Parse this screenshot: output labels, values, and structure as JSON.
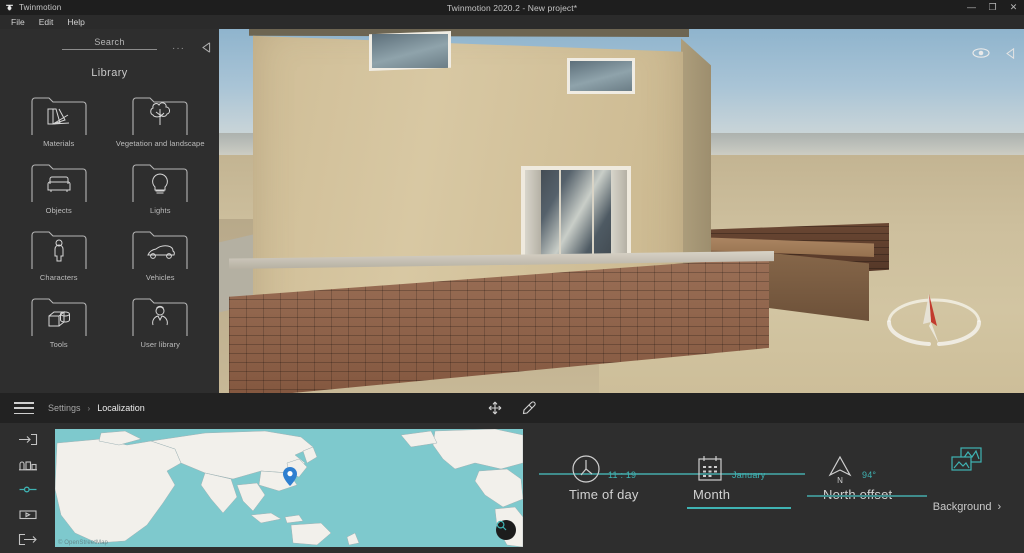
{
  "window": {
    "app_name": "Twinmotion",
    "title": "Twinmotion 2020.2 - New project*",
    "controls": {
      "minimize": "—",
      "maximize": "❐",
      "close": "✕"
    }
  },
  "menubar": {
    "items": [
      "File",
      "Edit",
      "Help"
    ]
  },
  "library": {
    "search_placeholder": "Search",
    "search_value": "Search",
    "more_label": "···",
    "title": "Library",
    "categories": [
      {
        "label": "Materials",
        "icon": "materials-folder-icon"
      },
      {
        "label": "Vegetation and landscape",
        "icon": "vegetation-folder-icon"
      },
      {
        "label": "Objects",
        "icon": "objects-folder-icon"
      },
      {
        "label": "Lights",
        "icon": "lights-folder-icon"
      },
      {
        "label": "Characters",
        "icon": "characters-folder-icon"
      },
      {
        "label": "Vehicles",
        "icon": "vehicles-folder-icon"
      },
      {
        "label": "Tools",
        "icon": "tools-folder-icon"
      },
      {
        "label": "User library",
        "icon": "user-library-folder-icon"
      }
    ]
  },
  "viewport": {
    "eye_icon": "visibility-eye-icon",
    "collapse_icon": "collapse-right-icon",
    "compass_icon": "compass-gizmo"
  },
  "bottombar": {
    "menu_icon": "hamburger-menu-icon",
    "breadcrumb": {
      "parent": "Settings",
      "separator": "›",
      "current": "Localization"
    },
    "tools": [
      {
        "name": "move-tool-icon"
      },
      {
        "name": "eyedropper-tool-icon"
      }
    ]
  },
  "rail": {
    "items": [
      {
        "name": "import-icon",
        "active": false
      },
      {
        "name": "urban-context-icon",
        "active": false
      },
      {
        "name": "settings-icon",
        "active": true
      },
      {
        "name": "media-icon",
        "active": false
      },
      {
        "name": "export-icon",
        "active": false
      }
    ]
  },
  "map": {
    "attribution": "© OpenStreetMap",
    "pin_label": "location-pin",
    "search_icon": "map-search-icon",
    "land_color": "#f2f0eb",
    "water_color": "#7ec9cd",
    "pin_color": "#2e7fd0"
  },
  "localization": {
    "accent_color": "#3fb3b3",
    "controls": [
      {
        "name": "Time of day",
        "value": "11 : 19",
        "icon": "clock-icon",
        "active": false
      },
      {
        "name": "Month",
        "value": "January",
        "icon": "calendar-icon",
        "active": true
      },
      {
        "name": "North offset",
        "value": "94°",
        "icon": "north-arrow-icon",
        "active": false
      }
    ],
    "background": {
      "label": "Background",
      "icon": "background-image-icon",
      "chevron": "›"
    }
  }
}
